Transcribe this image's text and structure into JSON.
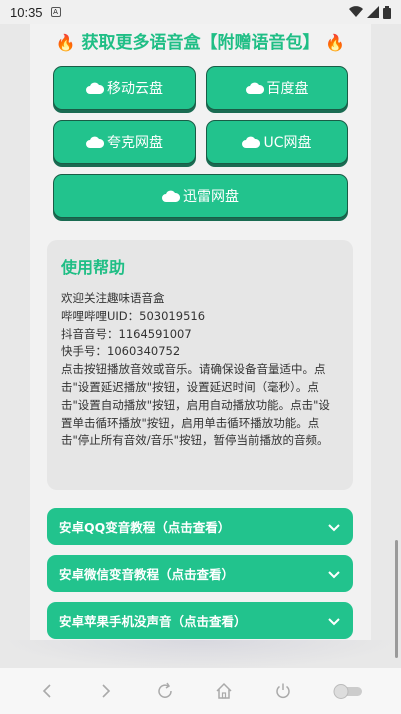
{
  "status": {
    "time": "10:35",
    "sim_label": "A"
  },
  "title": {
    "fire_left": "🔥",
    "text": "获取更多语音盒【附赠语音包】",
    "fire_right": "🔥"
  },
  "buttons": {
    "yidong": "移动云盘",
    "baidu": "百度盘",
    "kuake": "夸克网盘",
    "uc": "UC网盘",
    "xunlei": "迅雷网盘"
  },
  "help": {
    "heading": "使用帮助",
    "lines": [
      "欢迎关注趣味语音盒",
      "哔哩哔哩UID：503019516",
      "抖音音号：1164591007",
      "快手号：1060340752",
      "点击按钮播放音效或音乐。请确保设备音量适中。点击\"设置延迟播放\"按钮，设置延迟时间（毫秒）。点击\"设置自动播放\"按钮，启用自动播放功能。点击\"设置单击循环播放\"按钮，启用单击循环播放功能。点击\"停止所有音效/音乐\"按钮，暂停当前播放的音频。"
    ]
  },
  "accordions": [
    "安卓QQ变音教程（点击查看）",
    "安卓微信变音教程（点击查看）",
    "安卓苹果手机没声音（点击查看）"
  ],
  "colors": {
    "accent": "#22c38d",
    "title": "#1fbe85"
  }
}
